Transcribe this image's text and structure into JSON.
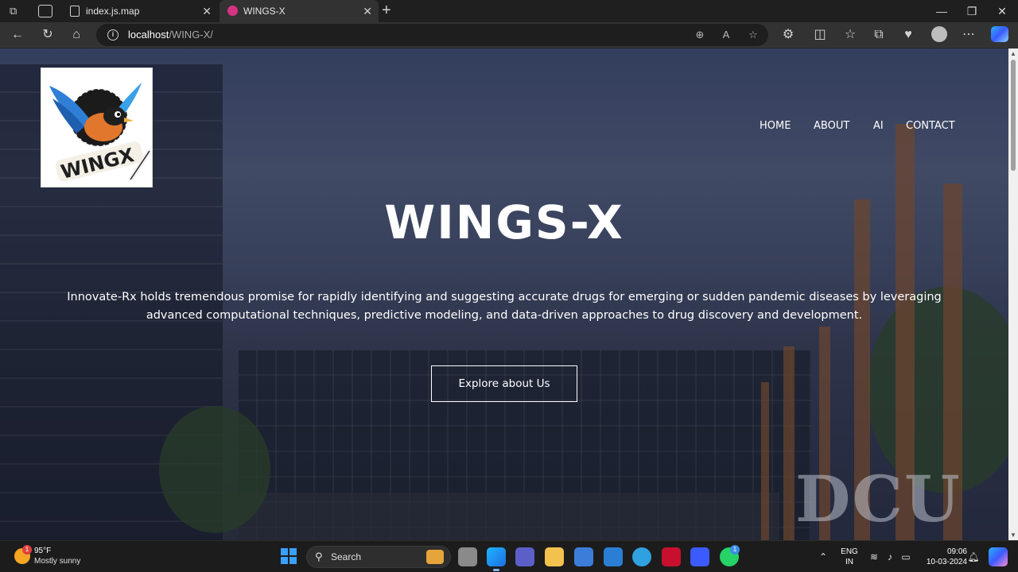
{
  "browser": {
    "tabs": [
      {
        "title": "index.js.map",
        "active": false
      },
      {
        "title": "WINGS-X",
        "active": true
      }
    ],
    "address": {
      "host": "localhost",
      "path": "/WING-X/"
    },
    "window_controls": {
      "minimize": "—",
      "maximize": "❐",
      "close": "✕"
    }
  },
  "page": {
    "logo_text": "WINGX",
    "nav": [
      "HOME",
      "ABOUT",
      "AI",
      "CONTACT"
    ],
    "hero_title": "WINGS-X",
    "hero_description": "Innovate-Rx holds tremendous promise for rapidly identifying and suggesting accurate drugs for emerging or sudden pandemic diseases by leveraging advanced computational techniques, predictive modeling, and data-driven approaches to drug discovery and development.",
    "cta": "Explore about Us",
    "background_sign": "DCU"
  },
  "taskbar": {
    "weather_temp": "95°F",
    "weather_desc": "Mostly sunny",
    "weather_badge": "1",
    "search_label": "Search",
    "whatsapp_badge": "1",
    "lang_line1": "ENG",
    "lang_line2": "IN",
    "time": "09:06",
    "date": "10-03-2024"
  },
  "colors": {
    "overlay": "#1c223c",
    "tab_active": "#323232",
    "accent_blue": "#3aa0ff"
  }
}
